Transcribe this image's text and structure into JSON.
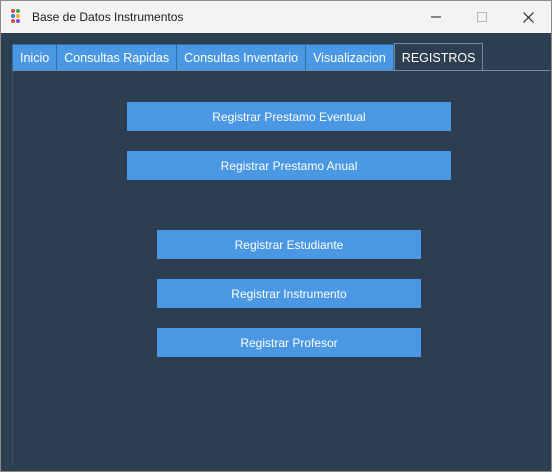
{
  "window": {
    "title": "Base de Datos Instrumentos",
    "icon": "app-dots-icon"
  },
  "tabs": [
    {
      "label": "Inicio",
      "active": false
    },
    {
      "label": "Consultas Rapidas",
      "active": false
    },
    {
      "label": "Consultas Inventario",
      "active": false
    },
    {
      "label": "Visualizacion",
      "active": false
    },
    {
      "label": "REGISTROS",
      "active": true
    }
  ],
  "buttons": {
    "prestamo_eventual": "Registrar Prestamo Eventual",
    "prestamo_anual": "Registrar Prestamo Anual",
    "estudiante": "Registrar Estudiante",
    "instrumento": "Registrar Instrumento",
    "profesor": "Registrar Profesor"
  },
  "colors": {
    "background": "#2c3e50",
    "button": "#4a98e3",
    "button_text": "#ffffff",
    "titlebar": "#f3f3f3"
  }
}
